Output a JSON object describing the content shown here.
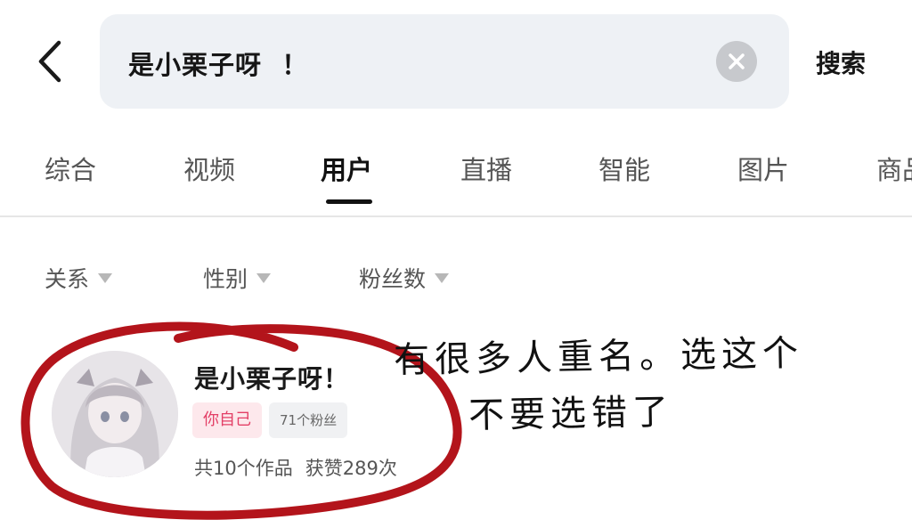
{
  "header": {
    "search_value": "是小栗子呀  ！",
    "search_label": "搜索"
  },
  "tabs": [
    {
      "label": "综合",
      "active": false
    },
    {
      "label": "视频",
      "active": false
    },
    {
      "label": "用户",
      "active": true
    },
    {
      "label": "直播",
      "active": false
    },
    {
      "label": "智能",
      "active": false
    },
    {
      "label": "图片",
      "active": false
    },
    {
      "label": "商品",
      "active": false
    }
  ],
  "filters": [
    {
      "label": "关系"
    },
    {
      "label": "性别"
    },
    {
      "label": "粉丝数"
    }
  ],
  "user_result": {
    "name": "是小栗子呀！",
    "tag_self": "你自己",
    "tag_fans": "71个粉丝",
    "works": "共10个作品",
    "likes": "获赞289次"
  },
  "annotation": {
    "line1": "有很多人重名。选这个",
    "line2": "不要选错了",
    "color": "#b3141b"
  },
  "colors": {
    "accent_pink": "#e33f66",
    "search_bg": "#eef1f5"
  }
}
